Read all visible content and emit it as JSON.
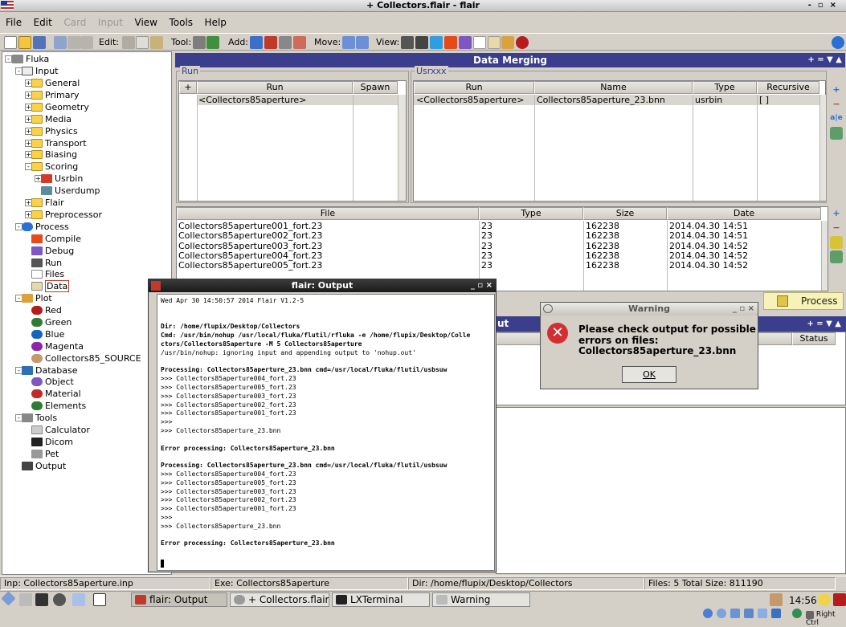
{
  "window": {
    "title": "+ Collectors.flair - flair",
    "controls": "-▫×"
  },
  "menu": [
    "File",
    "Edit",
    "Card",
    "Input",
    "View",
    "Tools",
    "Help"
  ],
  "toolbar": {
    "edit": "Edit:",
    "tool": "Tool:",
    "add": "Add:",
    "move": "Move:",
    "view": "View:"
  },
  "tree": {
    "root": "Fluka",
    "input": "Input",
    "input_items": [
      "General",
      "Primary",
      "Geometry",
      "Media",
      "Physics",
      "Transport",
      "Biasing",
      "Scoring"
    ],
    "scoring_items": [
      "Usrbin",
      "Userdump"
    ],
    "input_tail": [
      "Flair",
      "Preprocessor"
    ],
    "process": "Process",
    "process_items": [
      "Compile",
      "Debug",
      "Run",
      "Files",
      "Data"
    ],
    "plot": "Plot",
    "plot_items": [
      "Red",
      "Green",
      "Blue",
      "Magenta",
      "Collectors85_SOURCE"
    ],
    "database": "Database",
    "database_items": [
      "Object",
      "Material",
      "Elements"
    ],
    "tools": "Tools",
    "tools_items": [
      "Calculator",
      "Dicom",
      "Pet"
    ],
    "output": "Output"
  },
  "merging": {
    "title": "Data Merging",
    "header_icons": "+ = ▼ ▲",
    "run_group": "Run",
    "run_headers": [
      "+",
      "Run",
      "Spawn"
    ],
    "run_rows": [
      "<Collectors85aperture>"
    ],
    "usr_group": "Usrxxx",
    "usr_headers": [
      "Run",
      "Name",
      "Type",
      "Recursive"
    ],
    "usr_rows": [
      {
        "run": "<Collectors85aperture>",
        "name": "Collectors85aperture_23.bnn",
        "type": "usrbin",
        "recursive": "[ ]"
      }
    ],
    "file_headers": [
      "File",
      "Type",
      "Size",
      "Date"
    ],
    "files": [
      {
        "file": "Collectors85aperture001_fort.23",
        "type": "23",
        "size": "162238",
        "date": "2014.04.30 14:51"
      },
      {
        "file": "Collectors85aperture002_fort.23",
        "type": "23",
        "size": "162238",
        "date": "2014.04.30 14:51"
      },
      {
        "file": "Collectors85aperture003_fort.23",
        "type": "23",
        "size": "162238",
        "date": "2014.04.30 14:52"
      },
      {
        "file": "Collectors85aperture004_fort.23",
        "type": "23",
        "size": "162238",
        "date": "2014.04.30 14:52"
      },
      {
        "file": "Collectors85aperture005_fort.23",
        "type": "23",
        "size": "162238",
        "date": "2014.04.30 14:52"
      }
    ],
    "process_button": "Process",
    "output_partial": "ut",
    "status_header": "Status",
    "lower_icons": "+ = ▼ ▲"
  },
  "output_window": {
    "title": "flair: Output",
    "controls": "_ ▫ ×",
    "lines": [
      "Wed Apr 30 14:50:57 2014 Flair V1.2-5",
      "",
      "",
      "Dir: /home/flupix/Desktop/Collectors",
      "Cmd: /usr/bin/nohup /usr/local/fluka/flutil/rfluka -e /home/flupix/Desktop/Colle",
      "ctors/Collectors85aperture -M 5 Collectors85aperture",
      "/usr/bin/nohup: ignoring input and appending output to 'nohup.out'",
      "",
      "Processing: Collectors85aperture_23.bnn cmd=/usr/local/fluka/flutil/usbsuw",
      ">>> Collectors85aperture004_fort.23",
      ">>> Collectors85aperture005_fort.23",
      ">>> Collectors85aperture003_fort.23",
      ">>> Collectors85aperture002_fort.23",
      ">>> Collectors85aperture001_fort.23",
      ">>>",
      ">>> Collectors85aperture_23.bnn",
      "",
      "Error processing: Collectors85aperture_23.bnn",
      "",
      "Processing: Collectors85aperture_23.bnn cmd=/usr/local/fluka/flutil/usbsuw",
      ">>> Collectors85aperture004_fort.23",
      ">>> Collectors85aperture005_fort.23",
      ">>> Collectors85aperture003_fort.23",
      ">>> Collectors85aperture002_fort.23",
      ">>> Collectors85aperture001_fort.23",
      ">>>",
      ">>> Collectors85aperture_23.bnn",
      "",
      "Error processing: Collectors85aperture_23.bnn"
    ]
  },
  "warning": {
    "title": "Warning",
    "controls": "_ ▫ ×",
    "message1": "Please check output for possible",
    "message2": "errors on files:",
    "message3": "Collectors85aperture_23.bnn",
    "ok": "OK"
  },
  "status": {
    "inp": "Inp: Collectors85aperture.inp",
    "exe": "Exe: Collectors85aperture",
    "dir": "Dir: /home/flupix/Desktop/Collectors",
    "files": "Files: 5 Total Size: 811190"
  },
  "taskbar": {
    "tasks": [
      "flair: Output",
      "+ Collectors.flair ...",
      "LXTerminal",
      "Warning"
    ],
    "clock": "14:56",
    "right_ctrl": "Right Ctrl"
  },
  "colors": {
    "accent": "#3a3e8c",
    "warning_icon": "#d32f2f",
    "selection": "#d9d6cf"
  }
}
